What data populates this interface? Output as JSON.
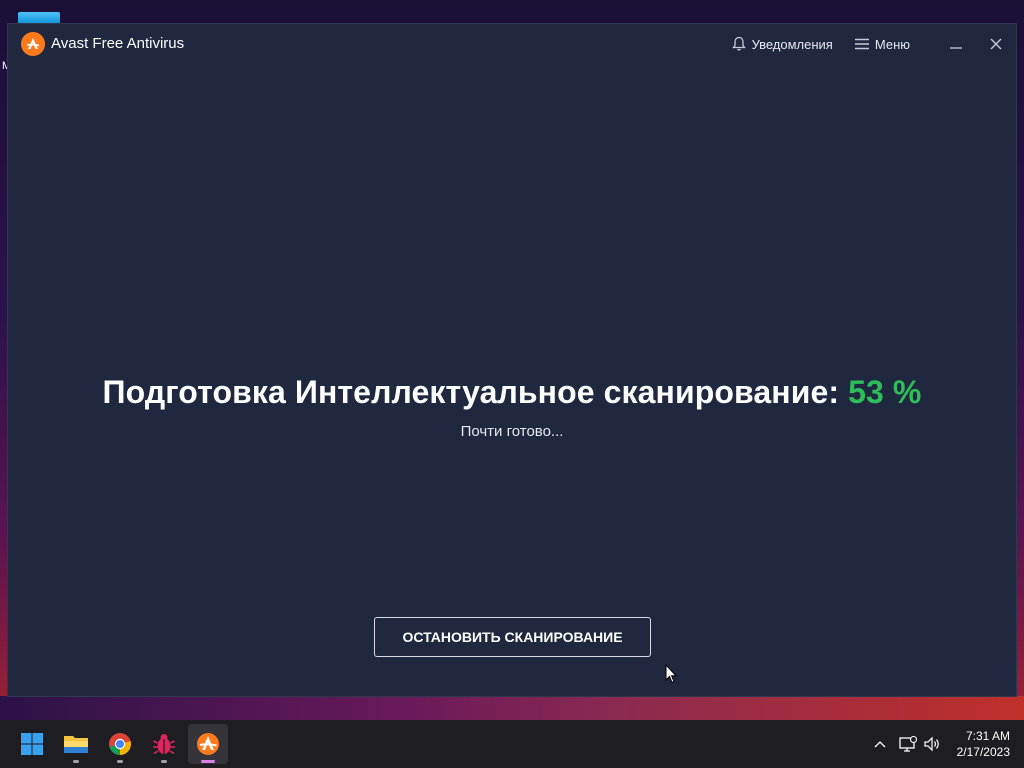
{
  "window": {
    "app_title": "Avast Free Antivirus",
    "notifications_label": "Уведомления",
    "menu_label": "Меню"
  },
  "scan": {
    "title": "Подготовка Интеллектуальное сканирование:",
    "percent_text": "53 %",
    "progress_percent": 53,
    "subtitle": "Почти готово...",
    "stop_button_label": "ОСТАНОВИТЬ СКАНИРОВАНИЕ",
    "percent_color": "#2dbe5a"
  },
  "desktop": {
    "partial_label": "M"
  },
  "taskbar": {
    "apps": [
      {
        "icon": "windows-start-icon"
      },
      {
        "icon": "file-explorer-icon"
      },
      {
        "icon": "chrome-icon"
      },
      {
        "icon": "bug-app-icon"
      },
      {
        "icon": "avast-icon",
        "active": true
      }
    ],
    "tray": [
      "chevron-up-icon",
      "network-icon",
      "volume-icon"
    ],
    "time": "7:31 AM",
    "date": "2/17/2023"
  },
  "colors": {
    "window_bg": "#202840",
    "accent_orange": "#ff7a1a",
    "taskbar_bg": "#1e1e22"
  }
}
